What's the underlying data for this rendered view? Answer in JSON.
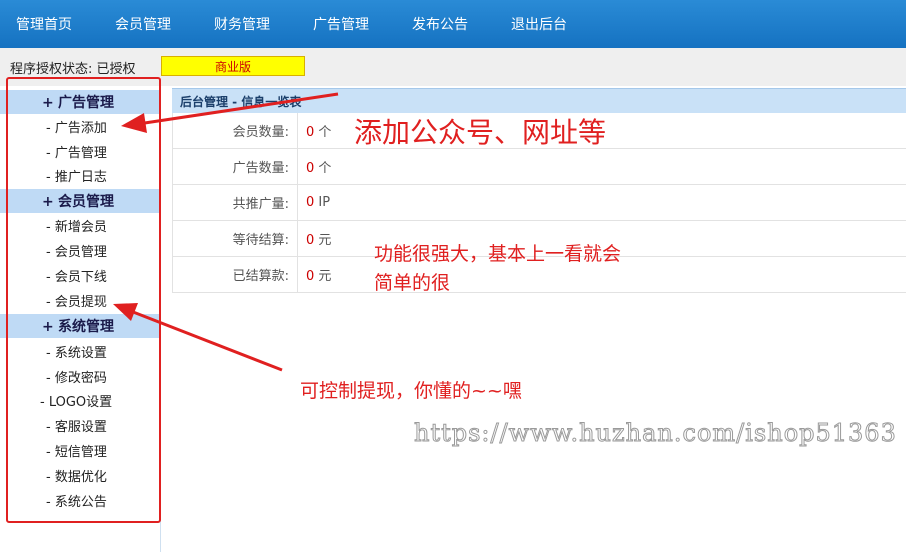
{
  "nav": {
    "items": [
      "管理首页",
      "会员管理",
      "财务管理",
      "广告管理",
      "发布公告",
      "退出后台"
    ]
  },
  "status": {
    "label": "程序授权状态: 已授权",
    "edition": "商业版"
  },
  "sidebar": {
    "groups": [
      {
        "plus": "+",
        "title": "广告管理",
        "items": [
          "- 广告添加",
          "- 广告管理",
          "- 推广日志"
        ]
      },
      {
        "plus": "+",
        "title": "会员管理",
        "items": [
          "- 新增会员",
          "- 会员管理",
          "- 会员下线",
          "- 会员提现"
        ]
      },
      {
        "plus": "+",
        "title": "系统管理",
        "items": [
          "- 系统设置",
          "- 修改密码",
          "- LOGO设置",
          "- 客服设置",
          "- 短信管理",
          "- 数据优化",
          "- 系统公告"
        ]
      }
    ]
  },
  "main": {
    "title": "后台管理 - 信息一览表",
    "rows": [
      {
        "label": "会员数量:",
        "value": "0",
        "unit": "个"
      },
      {
        "label": "广告数量:",
        "value": "0",
        "unit": "个"
      },
      {
        "label": "共推广量:",
        "value": "0",
        "unit": "IP"
      },
      {
        "label": "等待结算:",
        "value": "0",
        "unit": "元"
      },
      {
        "label": "已结算款:",
        "value": "0",
        "unit": "元"
      }
    ]
  },
  "annotations": {
    "note1": "添加公众号、网址等",
    "note2_line1": "功能很强大，基本上一看就会",
    "note2_line2": "简单的很",
    "note3": "可控制提现，你懂的~~嘿"
  },
  "watermark": "https://www.huzhan.com/ishop51363",
  "colors": {
    "nav_bg": "#1f80cf",
    "accent_red": "#e02020",
    "edition_bg": "#ffff00",
    "sidebar_group_bg": "#bfdaf5"
  }
}
